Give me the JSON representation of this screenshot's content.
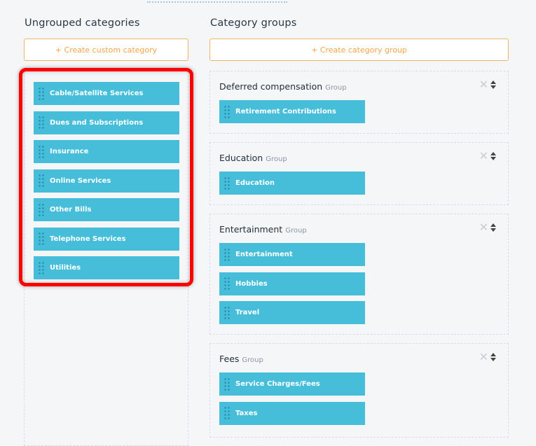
{
  "ungrouped": {
    "title": "Ungrouped categories",
    "create_label": "+ Create custom category",
    "items": [
      "Cable/Satellite Services",
      "Dues and Subscriptions",
      "Insurance",
      "Online Services",
      "Other Bills",
      "Telephone Services",
      "Utilities"
    ]
  },
  "groups_panel": {
    "title": "Category groups",
    "create_label": "+ Create category group",
    "group_tag": "Group",
    "groups": [
      {
        "name": "Deferred compensation",
        "items": [
          "Retirement Contributions"
        ]
      },
      {
        "name": "Education",
        "items": [
          "Education"
        ]
      },
      {
        "name": "Entertainment",
        "items": [
          "Entertainment",
          "Hobbies",
          "Travel"
        ]
      },
      {
        "name": "Fees",
        "items": [
          "Service Charges/Fees",
          "Taxes"
        ]
      }
    ]
  },
  "icons": {
    "drag": "drag-handle-icon",
    "remove": "close-icon",
    "sort": "sort-icon"
  },
  "colors": {
    "category_bg": "#47bed9",
    "accent_orange": "#f0a64c",
    "highlight_red": "#ff0000"
  }
}
